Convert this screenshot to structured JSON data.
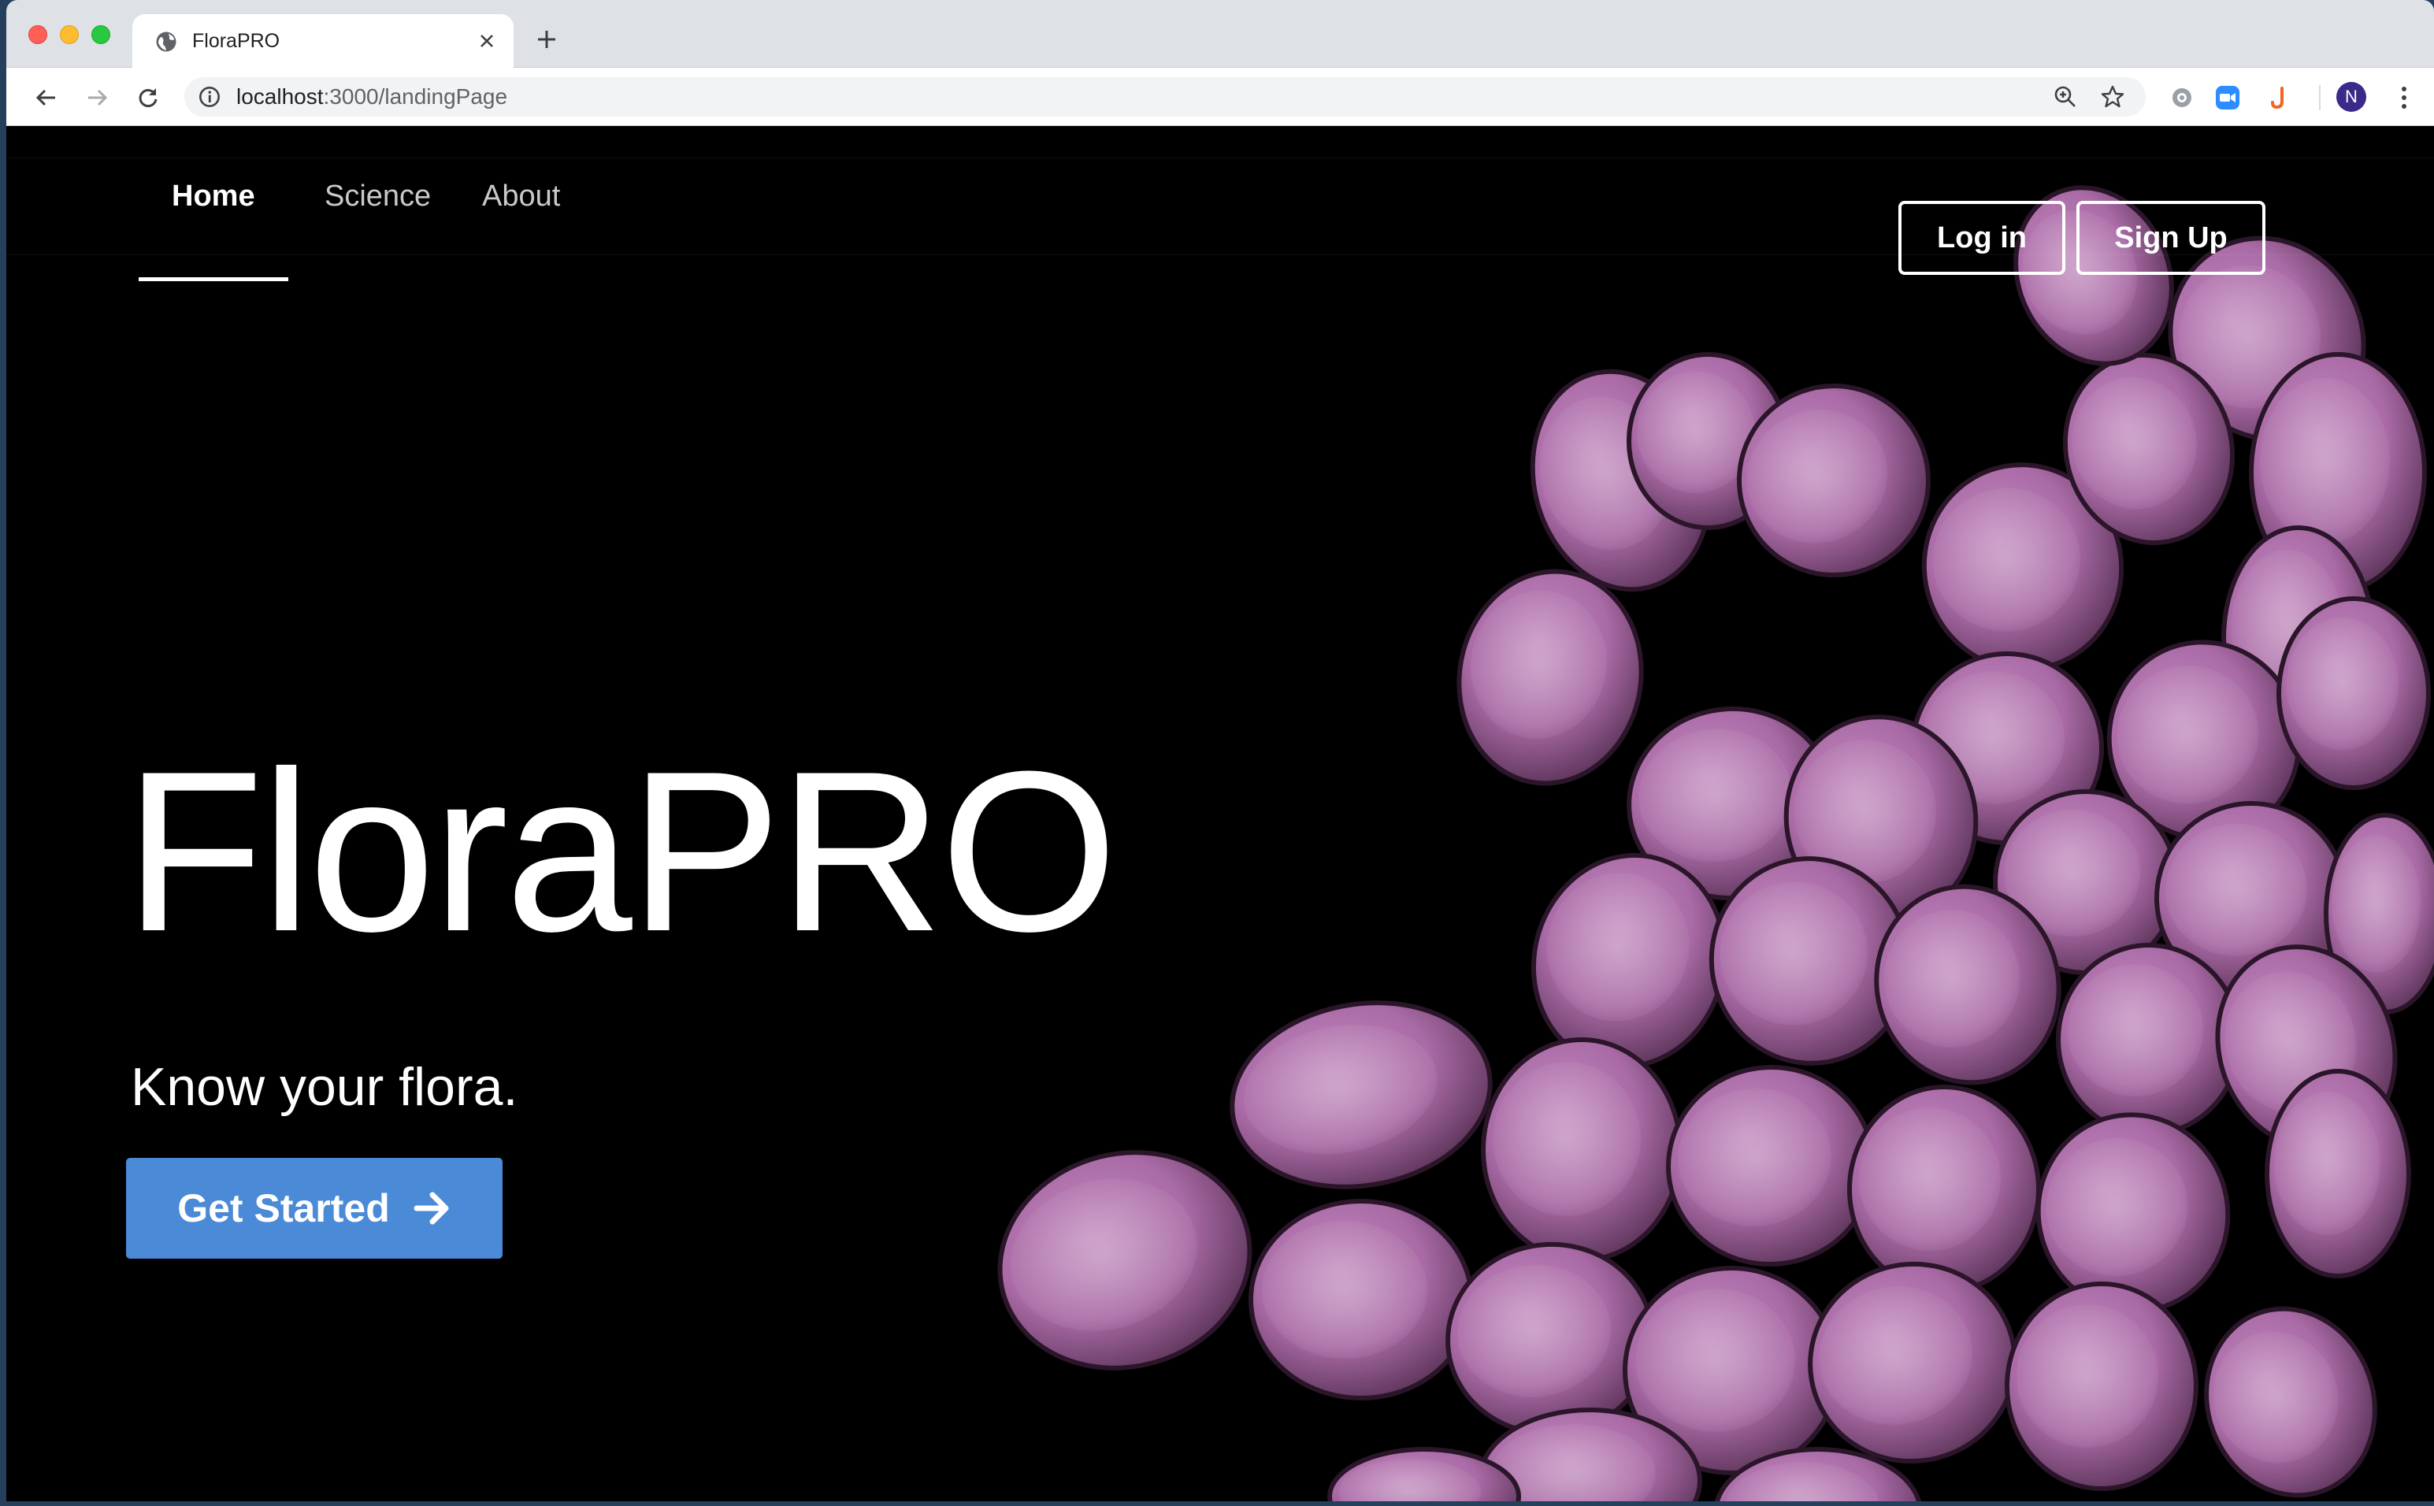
{
  "browser": {
    "tab": {
      "title": "FloraPRO",
      "favicon": "globe-icon",
      "close_icon": "close-icon"
    },
    "new_tab_icon": "plus-icon",
    "toolbar": {
      "back_icon": "back-arrow-icon",
      "forward_icon": "forward-arrow-icon",
      "reload_icon": "reload-icon",
      "url_host": "localhost",
      "url_path": ":3000/landingPage",
      "zoom_icon": "zoom-icon",
      "bookmark_icon": "star-icon",
      "extensions": [
        "extension-icon",
        "zoom-meeting-icon",
        "hook-extension-icon"
      ],
      "avatar_initial": "N",
      "menu_icon": "kebab-menu-icon"
    }
  },
  "page": {
    "nav": {
      "items": [
        {
          "label": "Home",
          "active": true
        },
        {
          "label": "Science",
          "active": false
        },
        {
          "label": "About",
          "active": false
        }
      ],
      "login_label": "Log in",
      "signup_label": "Sign Up"
    },
    "hero": {
      "title": "FloraPRO",
      "subtitle": "Know your flora.",
      "cta_label": "Get Started",
      "cta_icon": "arrow-right-icon",
      "background": "purple bacteria cluster photo"
    },
    "colors": {
      "background": "#000000",
      "cta": "#4a8ad6",
      "cell": "#b77fb2"
    }
  }
}
